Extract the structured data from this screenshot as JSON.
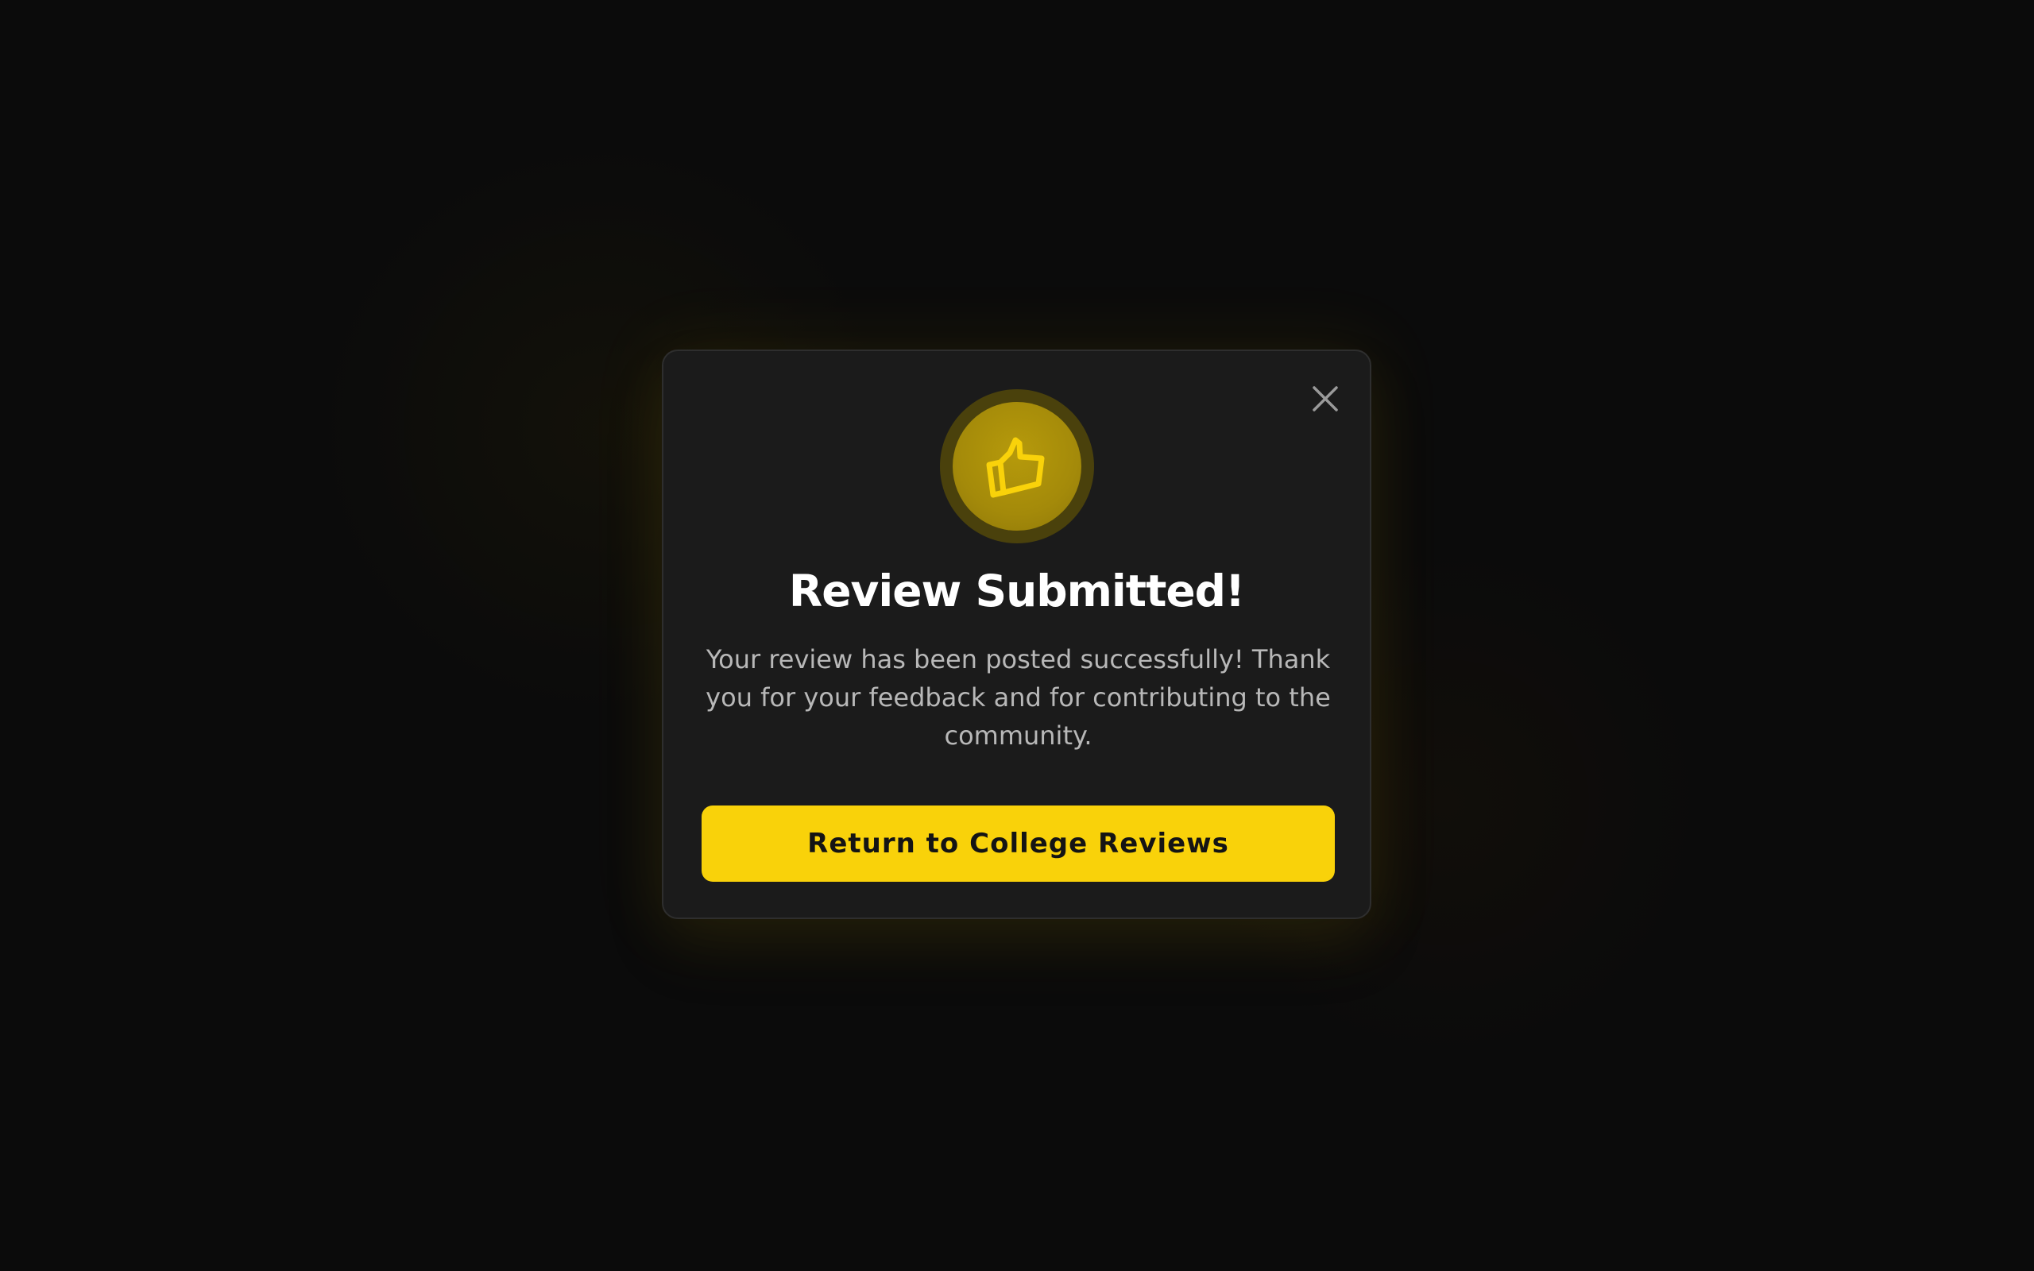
{
  "modal": {
    "title": "Review Submitted!",
    "message": "Your review has been posted successfully! Thank you for your feedback and for contributing to the community.",
    "primary_action_label": "Return to College Reviews",
    "close_icon": "close-icon",
    "status_icon": "thumbs-up-icon"
  },
  "colors": {
    "background": "#0b0b0b",
    "dialog_background": "#1b1b1b",
    "accent": "#f9d20a",
    "title": "#ffffff",
    "message": "#b8b8b8"
  }
}
